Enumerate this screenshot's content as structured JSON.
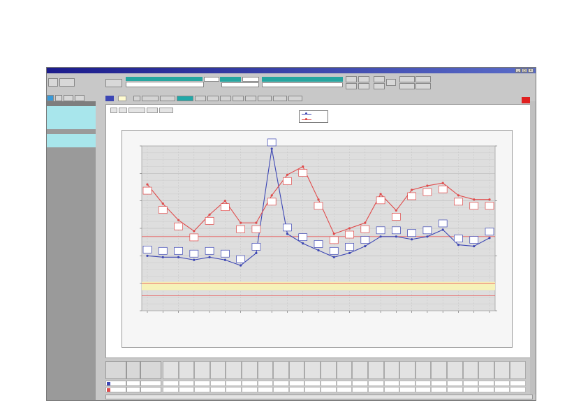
{
  "window": {
    "title": "",
    "controls": [
      "_",
      "□",
      "×"
    ]
  },
  "toolbar": {
    "buttons": [
      "",
      "",
      "",
      "",
      "",
      "",
      "",
      "",
      "",
      "",
      "",
      ""
    ],
    "patient_name": "",
    "patient_id": "",
    "date_range": "",
    "teal_fields": [
      "",
      "",
      "",
      ""
    ]
  },
  "sidebar": {
    "header": "",
    "rows": [
      "",
      "",
      "",
      "",
      "",
      "",
      ""
    ]
  },
  "tabs": [
    "",
    "",
    "",
    "",
    "",
    "",
    "",
    "",
    "",
    "",
    ""
  ],
  "active_tab_index": 3,
  "subtabs": [
    "",
    "",
    "",
    "",
    ""
  ],
  "legend": {
    "items": [
      {
        "label": "",
        "color": "#3c46b4"
      },
      {
        "label": "",
        "color": "#e04a4a"
      }
    ]
  },
  "colors": {
    "series_blue": "#3c46b4",
    "series_red": "#e04a4a",
    "accent_teal": "#26a6a0",
    "alert_red": "#e02020",
    "band_yellow": "#f6f2b8",
    "reference_red": "#e85a5a"
  },
  "chart_data": {
    "type": "line",
    "grid": true,
    "legend_position": "top",
    "x_count": 23,
    "x_ticks": [
      "",
      "",
      "",
      "",
      "",
      "",
      "",
      "",
      "",
      "",
      "",
      "",
      "",
      "",
      "",
      "",
      "",
      "",
      "",
      "",
      "",
      "",
      ""
    ],
    "y_left": {
      "label": "",
      "ticks": [
        "",
        "",
        "",
        "",
        "",
        "",
        ""
      ],
      "range": [
        0,
        6
      ]
    },
    "y_right": {
      "label": "",
      "ticks": [
        "",
        "",
        "",
        ""
      ],
      "range": [
        0,
        3
      ]
    },
    "reference_lines_left": [
      2.7,
      1.0,
      0.55
    ],
    "band_left": [
      0.75,
      1.05
    ],
    "series": [
      {
        "color": "#3c46b4",
        "values": [
          2.0,
          1.95,
          1.95,
          1.85,
          1.95,
          1.85,
          1.65,
          2.1,
          5.9,
          2.8,
          2.45,
          2.2,
          1.95,
          2.1,
          2.35,
          2.7,
          2.7,
          2.6,
          2.7,
          2.95,
          2.4,
          2.35,
          2.65
        ],
        "labels": [
          "",
          "",
          "",
          "",
          "",
          "",
          "",
          "",
          "",
          "",
          "",
          "",
          "",
          "",
          "",
          "",
          "",
          "",
          "",
          "",
          "",
          "",
          ""
        ]
      },
      {
        "color": "#e04a4a",
        "values": [
          4.6,
          3.9,
          3.3,
          2.9,
          3.5,
          4.0,
          3.2,
          3.2,
          4.2,
          4.95,
          5.25,
          4.05,
          2.8,
          3.0,
          3.2,
          4.25,
          3.65,
          4.4,
          4.55,
          4.65,
          4.2,
          4.05,
          4.05
        ],
        "labels": [
          "",
          "",
          "",
          "",
          "",
          "",
          "",
          "",
          "",
          "",
          "",
          "",
          "",
          "",
          "",
          "",
          "",
          "",
          "",
          "",
          "",
          "",
          ""
        ]
      }
    ]
  },
  "table": {
    "headers": [
      "",
      "",
      ""
    ],
    "rows": [
      {
        "name": "",
        "unit": "",
        "range": "",
        "color": "#3c46b4",
        "values": [
          "",
          "",
          "",
          "",
          "",
          "",
          "",
          "",
          "",
          "",
          "",
          "",
          "",
          "",
          "",
          "",
          "",
          "",
          "",
          "",
          "",
          "",
          ""
        ]
      },
      {
        "name": "",
        "unit": "",
        "range": "",
        "color": "#e04a4a",
        "values": [
          "",
          "",
          "",
          "",
          "",
          "",
          "",
          "",
          "",
          "",
          "",
          "",
          "",
          "",
          "",
          "",
          "",
          "",
          "",
          "",
          "",
          "",
          ""
        ]
      }
    ]
  }
}
